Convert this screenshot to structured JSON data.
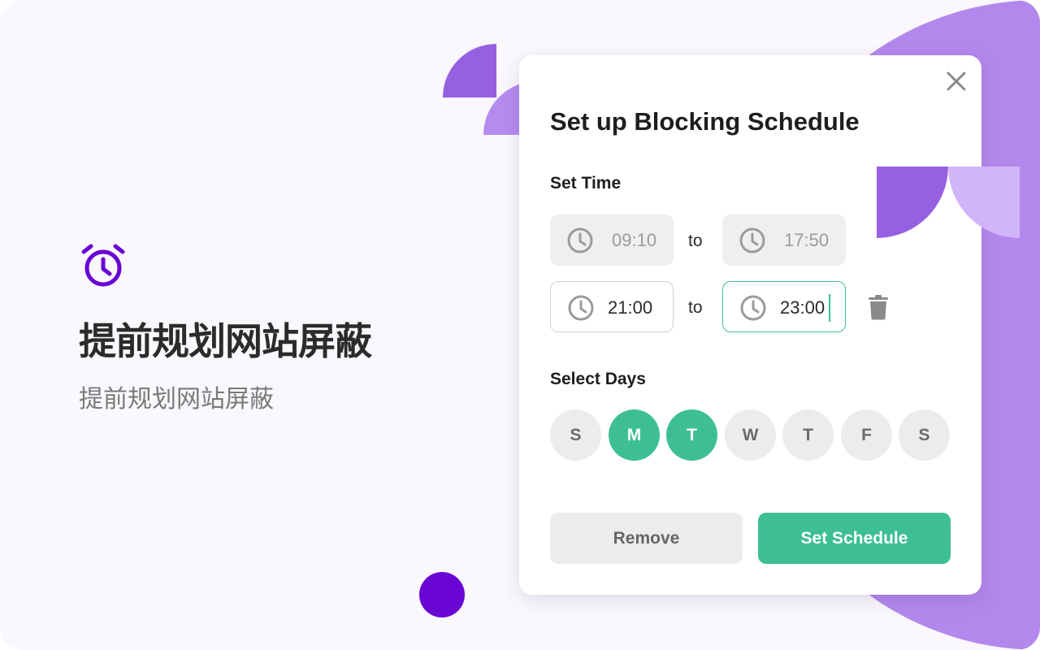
{
  "hero": {
    "title": "提前规划网站屏蔽",
    "subtitle": "提前规划网站屏蔽",
    "icon": "alarm-clock-icon",
    "accent_color": "#6a06d4"
  },
  "dialog": {
    "title": "Set up Blocking Schedule",
    "close_icon": "close-icon",
    "time_section_label": "Set Time",
    "time_ranges": [
      {
        "start": "09:10",
        "end": "17:50",
        "state": "disabled",
        "connector": "to"
      },
      {
        "start": "21:00",
        "end": "23:00",
        "state": "editing",
        "connector": "to",
        "end_focused": true
      }
    ],
    "delete_icon": "trash-icon",
    "days_section_label": "Select Days",
    "days": [
      {
        "label": "S",
        "selected": false
      },
      {
        "label": "M",
        "selected": true
      },
      {
        "label": "T",
        "selected": true
      },
      {
        "label": "W",
        "selected": false
      },
      {
        "label": "T",
        "selected": false
      },
      {
        "label": "F",
        "selected": false
      },
      {
        "label": "S",
        "selected": false
      }
    ],
    "remove_label": "Remove",
    "set_label": "Set Schedule"
  },
  "colors": {
    "accent_green": "#3dbf92",
    "purple_blob": "#b388ec",
    "purple_dark": "#9760e0",
    "purple_dot": "#6a06d4"
  }
}
